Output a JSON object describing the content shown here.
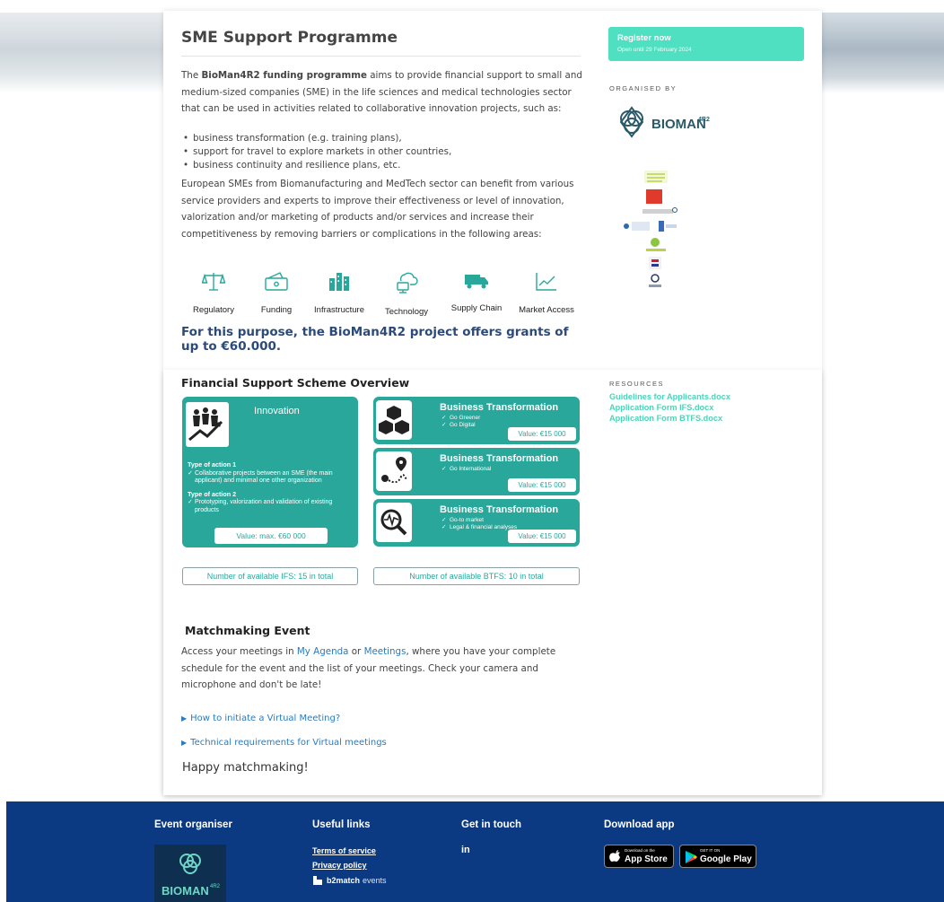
{
  "main": {
    "title": "SME Support Programme",
    "intro_prefix": "The ",
    "intro_bold": "BioMan4R2 funding programme",
    "intro_rest": " aims to provide financial support to small and medium-sized companies (SME) in the life sciences and medical technologies sector that can be used in activities related to collaborative innovation projects, such as:",
    "bullets": [
      "business transformation (e.g. training plans),",
      "support for travel to explore markets in other countries,",
      "business continuity and resilience plans, etc."
    ],
    "paragraph2": "European SMEs from Biomanufacturing and MedTech sector can benefit from various service providers and experts to improve their effectiveness or level of innovation, valorization and/or marketing of products and/or services and increase their competitiveness by removing barriers or complications in the following areas:",
    "areas": [
      {
        "label": "Regulatory",
        "icon": "scale-icon"
      },
      {
        "label": "Funding",
        "icon": "wallet-icon"
      },
      {
        "label": "Infrastructure",
        "icon": "buildings-icon"
      },
      {
        "label": "Technology",
        "icon": "cloud-computer-icon"
      },
      {
        "label": "Supply Chain",
        "icon": "truck-icon"
      },
      {
        "label": "Market Access",
        "icon": "chart-line-icon"
      }
    ],
    "grant_text": "For this purpose, the BioMan4R2 project offers grants of up to €60.000."
  },
  "scheme": {
    "title": "Financial Support Scheme Overview",
    "innovation": {
      "title": "Innovation",
      "action1_title": "Type of action 1",
      "action1_item": "Collaborative projects between an SME (the main applicant) and minimal one other organization",
      "action2_title": "Type of action 2",
      "action2_item": "Prototyping, valorization and validation of existing products",
      "value": "Value: max. €60 000"
    },
    "bt1": {
      "title": "Business Transformation",
      "items": [
        "Go Greener",
        "Go Digital"
      ],
      "value": "Value: €15 000"
    },
    "bt2": {
      "title": "Business Transformation",
      "items": [
        "Go International"
      ],
      "value": "Value: €15 000"
    },
    "bt3": {
      "title": "Business Transformation",
      "items": [
        "Go-to market",
        "Legal & financial analyses"
      ],
      "value": "Value: €15 000"
    },
    "avail_ifs": "Number of available IFS: 15 in total",
    "avail_btfs": "Number of available BTFS: 10 in total"
  },
  "matchmaking": {
    "title": "Matchmaking Event",
    "text_1": "Access your meetings in ",
    "link_agenda": "My Agenda",
    "text_2": " or ",
    "link_meetings": "Meetings",
    "text_3": ", where you have your complete schedule for the event and the list of your meetings. Check your camera and microphone and don't be late!",
    "toggle_1": "How to initiate a Virtual Meeting?",
    "toggle_2": "Technical requirements for Virtual meetings",
    "happy": "Happy matchmaking!"
  },
  "sidebar": {
    "register_label": "Register now",
    "register_sub": "Open until 29 February 2024",
    "organised_by": "ORGANISED BY",
    "bioman_logo_text": "BIOMAN",
    "bioman_logo_sup": "4R2",
    "resources": "RESOURCES",
    "resource_links": [
      "Guidelines for Applicants.docx",
      "Application Form IFS.docx",
      "Application Form BTFS.docx"
    ]
  },
  "footer": {
    "event_organiser": "Event organiser",
    "useful_links": "Useful links",
    "get_in_touch": "Get in touch",
    "download_app": "Download app",
    "terms": "Terms of service",
    "privacy": "Privacy policy",
    "b2match": "b2match",
    "b2match_events": "events",
    "linkedin": "in",
    "appstore_small": "Download on the",
    "appstore_big": "App Store",
    "googleplay_small": "GET IT ON",
    "googleplay_big": "Google Play",
    "org_logo_text": "BIOMAN",
    "org_logo_sup": "4R2"
  },
  "colors": {
    "teal": "#29a79a",
    "register": "#4fe0c2",
    "footer": "#0b3a82",
    "grant_text": "#2b4a7a",
    "link": "#2a7bbf"
  }
}
